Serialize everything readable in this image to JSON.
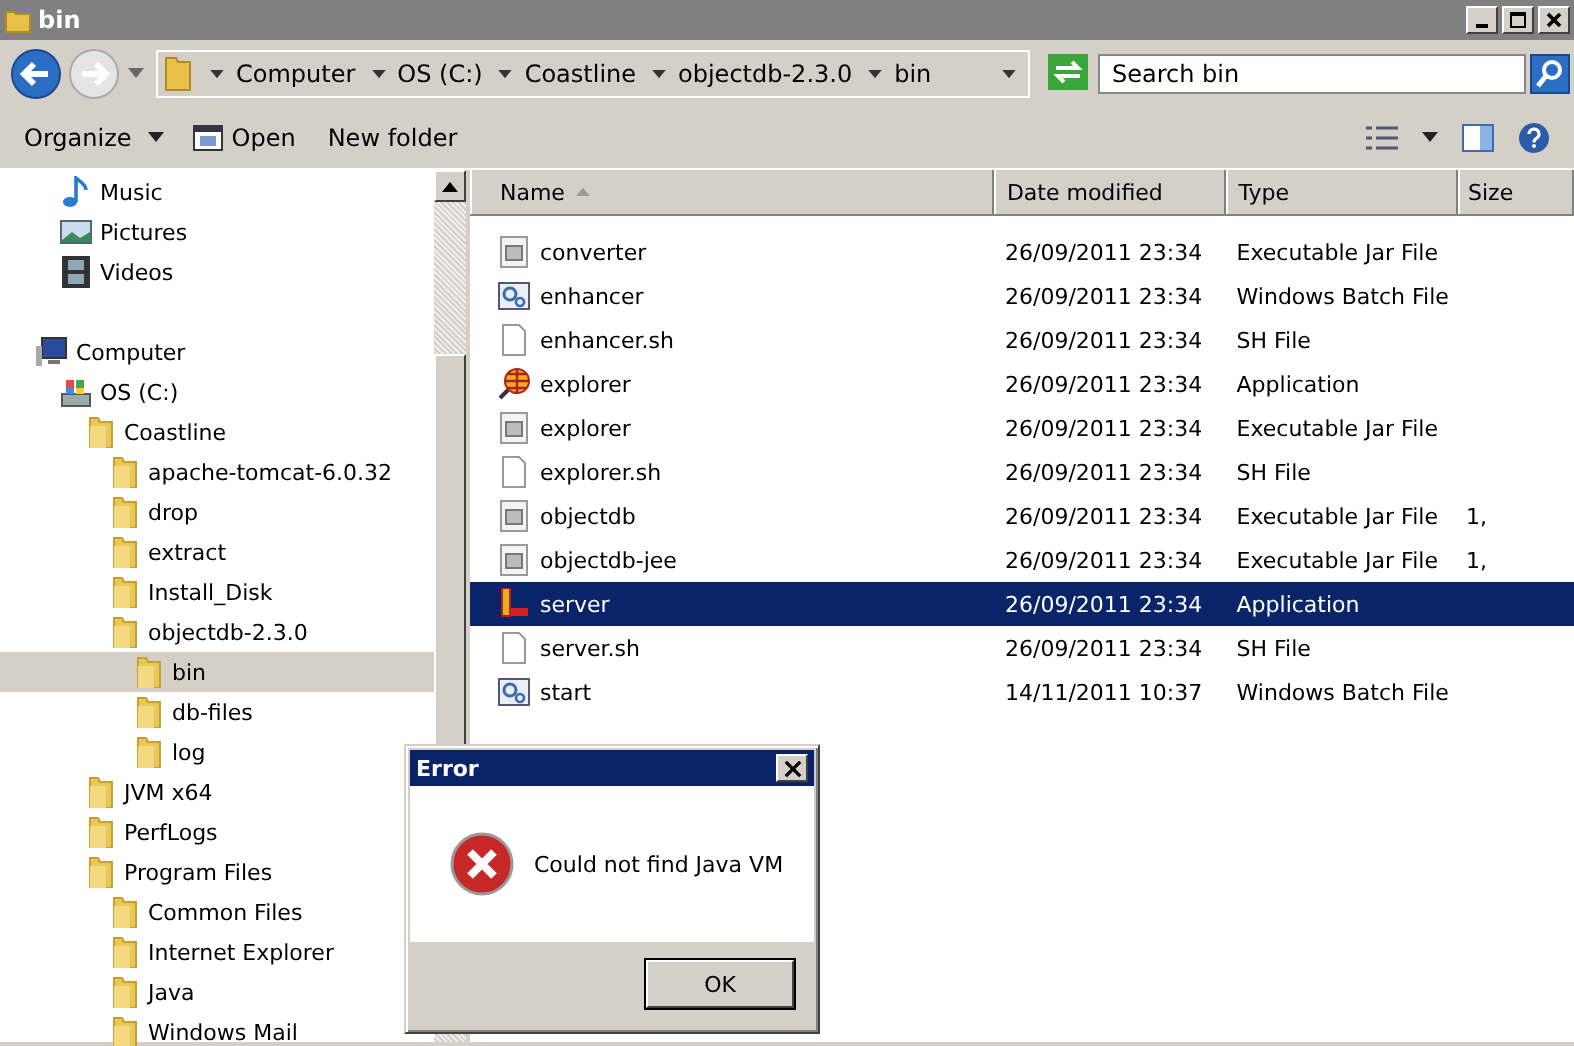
{
  "window": {
    "title": "bin"
  },
  "address": {
    "crumbs": [
      "Computer",
      "OS (C:)",
      "Coastline",
      "objectdb-2.3.0",
      "bin"
    ]
  },
  "search": {
    "placeholder": "Search bin"
  },
  "toolbar": [
    "Organize",
    "Open",
    "New folder"
  ],
  "nav_libraries": [
    {
      "label": "Music",
      "kind": "music",
      "selected": false
    },
    {
      "label": "Pictures",
      "kind": "pictures",
      "selected": false
    },
    {
      "label": "Videos",
      "kind": "videos",
      "selected": false
    }
  ],
  "nav_tree": [
    {
      "label": "Computer",
      "kind": "computer",
      "selected": false,
      "children": [
        {
          "label": "OS (C:)",
          "kind": "drive",
          "selected": false,
          "children": [
            {
              "label": "Coastline",
              "kind": "folder",
              "selected": false,
              "children": [
                {
                  "label": "apache-tomcat-6.0.32",
                  "kind": "folder",
                  "selected": false
                },
                {
                  "label": "drop",
                  "kind": "folder",
                  "selected": false
                },
                {
                  "label": "extract",
                  "kind": "folder",
                  "selected": false
                },
                {
                  "label": "Install_Disk",
                  "kind": "folder",
                  "selected": false
                },
                {
                  "label": "objectdb-2.3.0",
                  "kind": "folder",
                  "selected": false,
                  "children": [
                    {
                      "label": "bin",
                      "kind": "folder",
                      "selected": true
                    },
                    {
                      "label": "db-files",
                      "kind": "folder",
                      "selected": false
                    },
                    {
                      "label": "log",
                      "kind": "folder",
                      "selected": false
                    }
                  ]
                }
              ]
            },
            {
              "label": "JVM x64",
              "kind": "folder",
              "selected": false
            },
            {
              "label": "PerfLogs",
              "kind": "folder",
              "selected": false
            },
            {
              "label": "Program Files",
              "kind": "folder",
              "selected": false,
              "children": [
                {
                  "label": "Common Files",
                  "kind": "folder",
                  "selected": false
                },
                {
                  "label": "Internet Explorer",
                  "kind": "folder",
                  "selected": false
                },
                {
                  "label": "Java",
                  "kind": "folder",
                  "selected": false
                },
                {
                  "label": "Windows Mail",
                  "kind": "folder",
                  "selected": false
                }
              ]
            }
          ]
        }
      ]
    }
  ],
  "table": {
    "columns": [
      "Name",
      "Date modified",
      "Type",
      "Size"
    ],
    "rows": [
      {
        "name": "converter",
        "date": "26/09/2011 23:34",
        "type": "Executable Jar File",
        "kind": "jar",
        "selected": false
      },
      {
        "name": "enhancer",
        "date": "26/09/2011 23:34",
        "type": "Windows Batch File",
        "kind": "batch",
        "selected": false
      },
      {
        "name": "enhancer.sh",
        "date": "26/09/2011 23:34",
        "type": "SH File",
        "kind": "sh",
        "selected": false
      },
      {
        "name": "explorer",
        "date": "26/09/2011 23:34",
        "type": "Application",
        "kind": "globe",
        "selected": false
      },
      {
        "name": "explorer",
        "date": "26/09/2011 23:34",
        "type": "Executable Jar File",
        "kind": "jar",
        "selected": false
      },
      {
        "name": "explorer.sh",
        "date": "26/09/2011 23:34",
        "type": "SH File",
        "kind": "sh",
        "selected": false
      },
      {
        "name": "objectdb",
        "date": "26/09/2011 23:34",
        "type": "Executable Jar File",
        "size": "1,",
        "kind": "jar",
        "selected": false
      },
      {
        "name": "objectdb-jee",
        "date": "26/09/2011 23:34",
        "type": "Executable Jar File",
        "size": "1,",
        "kind": "jar",
        "selected": false
      },
      {
        "name": "server",
        "date": "26/09/2011 23:34",
        "type": "Application",
        "kind": "server",
        "selected": true
      },
      {
        "name": "server.sh",
        "date": "26/09/2011 23:34",
        "type": "SH File",
        "kind": "sh",
        "selected": false
      },
      {
        "name": "start",
        "date": "14/11/2011 10:37",
        "type": "Windows Batch File",
        "kind": "batch",
        "selected": false
      }
    ]
  },
  "dialog": {
    "title": "Error",
    "message": "Could not find Java VM",
    "button": "OK"
  }
}
